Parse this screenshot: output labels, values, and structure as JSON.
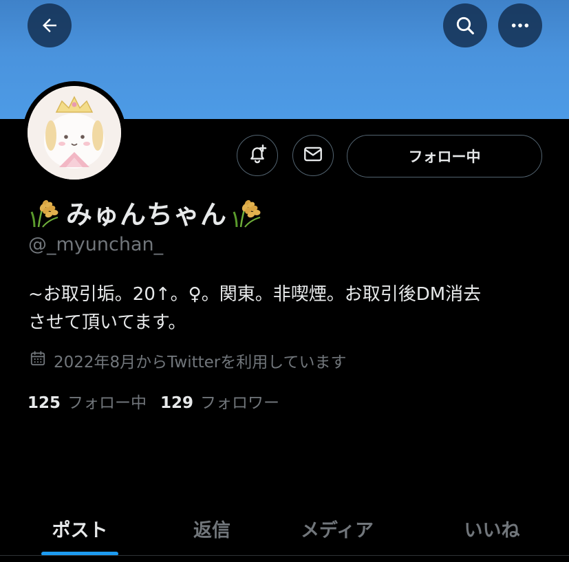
{
  "header": {
    "back_icon": "arrow-left-icon",
    "search_icon": "search-icon",
    "more_icon": "more-horizontal-icon",
    "banner_color": "#4a93dd"
  },
  "profile": {
    "name_prefix_icon": "rice-ear-emoji",
    "display_name": "みゅんちゃん",
    "name_suffix_icon": "rice-ear-emoji",
    "handle": "@_myunchan_",
    "bio_line1": "~お取引垢。20↑。♀。関東。非喫煙。お取引後DM消去",
    "bio_line2": "させて頂いてます。",
    "joined_icon": "calendar-icon",
    "joined_text": "2022年8月からTwitterを利用しています"
  },
  "actions": {
    "notify_icon": "bell-plus-icon",
    "mail_icon": "envelope-icon",
    "follow_label": "フォロー中"
  },
  "stats": {
    "following_count": "125",
    "following_label": "フォロー中",
    "followers_count": "129",
    "followers_label": "フォロワー"
  },
  "tabs": [
    {
      "label": "ポスト",
      "active": true
    },
    {
      "label": "返信",
      "active": false
    },
    {
      "label": "メディア",
      "active": false
    },
    {
      "label": "いいね",
      "active": false
    }
  ],
  "colors": {
    "background": "#000000",
    "text": "#e7e9ea",
    "muted": "#71767b",
    "accent": "#1d9bf0",
    "border": "#536471"
  }
}
